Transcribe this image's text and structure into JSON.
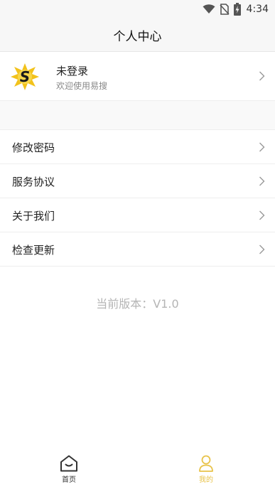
{
  "status_bar": {
    "time": "4:34",
    "icons": [
      "wifi-icon",
      "no-sim-icon",
      "battery-charging-icon"
    ]
  },
  "header": {
    "title": "个人中心"
  },
  "profile": {
    "name": "未登录",
    "subtitle": "欢迎使用易搜",
    "logo_letter": "S",
    "logo_icon": "app-logo-icon"
  },
  "menu": {
    "items": [
      {
        "label": "修改密码",
        "icon": "chevron-right-icon"
      },
      {
        "label": "服务协议",
        "icon": "chevron-right-icon"
      },
      {
        "label": "关于我们",
        "icon": "chevron-right-icon"
      },
      {
        "label": "检查更新",
        "icon": "chevron-right-icon"
      }
    ]
  },
  "version_text": "当前版本：V1.0",
  "tabbar": {
    "tabs": [
      {
        "label": "首页",
        "icon": "home-icon",
        "active": false
      },
      {
        "label": "我的",
        "icon": "user-icon",
        "active": true
      }
    ]
  },
  "colors": {
    "accent": "#e8c34a",
    "header_bg": "#f7f7f7",
    "divider": "#eeeeee",
    "muted_text": "#b5b5b5"
  }
}
